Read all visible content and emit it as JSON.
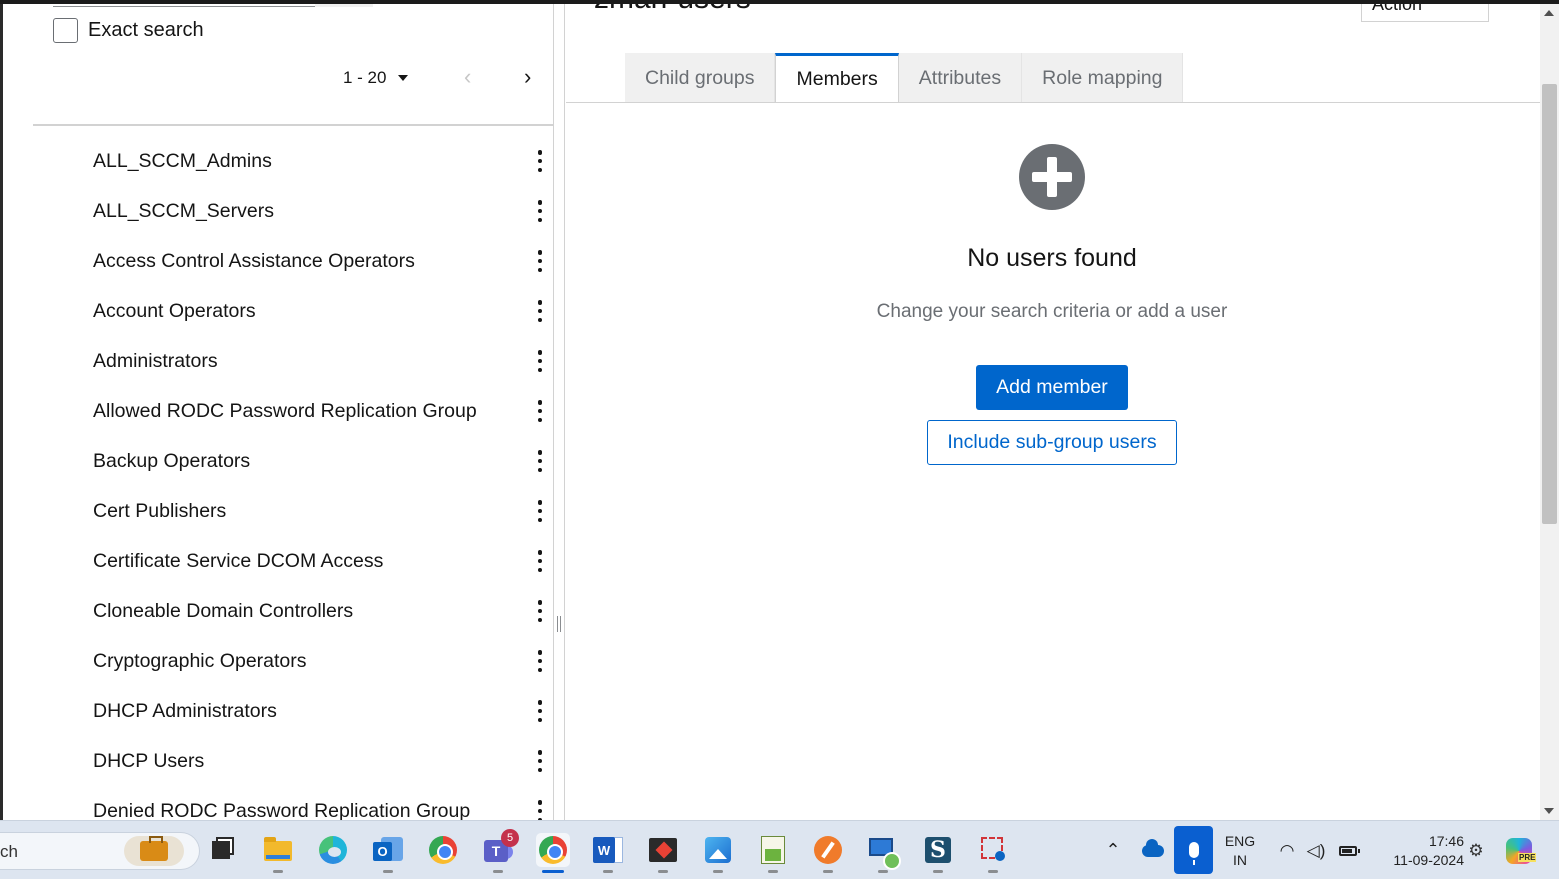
{
  "left_panel": {
    "exact_search_label": "Exact search",
    "pagination": {
      "range": "1 - 20",
      "prev_icon": "chevron-left-icon",
      "next_icon": "chevron-right-icon"
    },
    "groups": [
      "ALL_SCCM_Admins",
      "ALL_SCCM_Servers",
      "Access Control Assistance Operators",
      "Account Operators",
      "Administrators",
      "Allowed RODC Password Replication Group",
      "Backup Operators",
      "Cert Publishers",
      "Certificate Service DCOM Access",
      "Cloneable Domain Controllers",
      "Cryptographic Operators",
      "DHCP Administrators",
      "DHCP Users",
      "Denied RODC Password Replication Group"
    ]
  },
  "right_panel": {
    "title": "zman-users",
    "action_label": "Action",
    "tabs": [
      "Child groups",
      "Members",
      "Attributes",
      "Role mapping"
    ],
    "active_tab": "Members",
    "empty_state": {
      "icon": "plus-circle-icon",
      "title": "No users found",
      "body": "Change your search criteria or add a user",
      "primary_action": "Add member",
      "secondary_action": "Include sub-group users"
    }
  },
  "taskbar": {
    "search_text": "ch",
    "apps": [
      {
        "name": "task-view",
        "icon": "desktop-icon"
      },
      {
        "name": "file-explorer",
        "icon": "folder-icon"
      },
      {
        "name": "edge",
        "icon": "edge-icon"
      },
      {
        "name": "outlook",
        "icon": "outlook-icon"
      },
      {
        "name": "chrome",
        "icon": "chrome-icon"
      },
      {
        "name": "teams",
        "icon": "teams-icon",
        "badge": "5"
      },
      {
        "name": "chrome-active",
        "icon": "chrome-icon"
      },
      {
        "name": "word",
        "icon": "word-icon"
      },
      {
        "name": "snip",
        "icon": "snip-icon"
      },
      {
        "name": "photos",
        "icon": "photos-icon"
      },
      {
        "name": "notepad-plus",
        "icon": "notepad-icon"
      },
      {
        "name": "pen-app",
        "icon": "pencil-icon"
      },
      {
        "name": "remote-desktop",
        "icon": "remote-desktop-icon"
      },
      {
        "name": "sublime",
        "icon": "sublime-icon"
      },
      {
        "name": "snipping-tool",
        "icon": "scissor-icon"
      }
    ],
    "tray": {
      "language": "ENG",
      "region": "IN",
      "time": "17:46",
      "date": "11-09-2024"
    }
  },
  "colors": {
    "accent": "#0066cc",
    "tab_inactive_bg": "#f0f0f0",
    "muted_text": "#6a6e73"
  }
}
